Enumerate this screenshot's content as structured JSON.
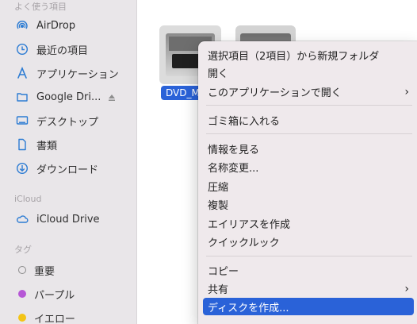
{
  "sidebar": {
    "sections": {
      "favorites_title": "よく使う項目",
      "icloud_title": "iCloud",
      "tags_title": "タグ"
    },
    "favorites": [
      {
        "label": "AirDrop",
        "icon": "airdrop-icon"
      },
      {
        "label": "最近の項目",
        "icon": "clock-icon"
      },
      {
        "label": "アプリケーション",
        "icon": "apps-icon"
      },
      {
        "label": "Google Dri...",
        "icon": "folder-icon"
      },
      {
        "label": "デスクトップ",
        "icon": "desktop-icon"
      },
      {
        "label": "書類",
        "icon": "document-icon"
      },
      {
        "label": "ダウンロード",
        "icon": "download-icon"
      }
    ],
    "icloud": [
      {
        "label": "iCloud Drive",
        "icon": "cloud-icon"
      }
    ],
    "tags": [
      {
        "label": "重要",
        "color": "#8b8b8b"
      },
      {
        "label": "パープル",
        "color": "#b657d6"
      },
      {
        "label": "イエロー",
        "color": "#f3c416"
      }
    ]
  },
  "main": {
    "selected_file_label": "DVD_M"
  },
  "context_menu": {
    "items": [
      {
        "label": "選択項目（2項目）から新規フォルダ"
      },
      {
        "label": "開く"
      },
      {
        "label": "このアプリケーションで開く",
        "submenu": true
      },
      {
        "label": "ゴミ箱に入れる"
      },
      {
        "label": "情報を見る"
      },
      {
        "label": "名称変更..."
      },
      {
        "label": "圧縮"
      },
      {
        "label": "複製"
      },
      {
        "label": "エイリアスを作成"
      },
      {
        "label": "クイックルック"
      },
      {
        "label": "コピー"
      },
      {
        "label": "共有",
        "submenu": true
      },
      {
        "label": "ディスクを作成...",
        "highlighted": true
      }
    ]
  },
  "colors": {
    "accent": "#2a62d8",
    "sidebar_icon": "#2b7bd3",
    "menu_bg": "#efe9ec",
    "sidebar_bg": "#e9e6e9"
  }
}
